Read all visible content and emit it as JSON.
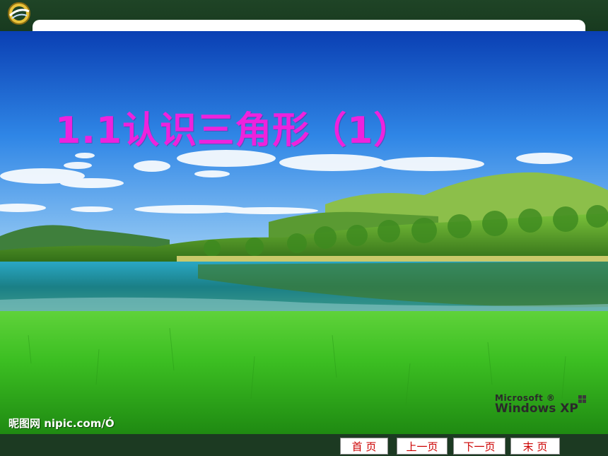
{
  "slide": {
    "title": "1.1认识三角形（1）",
    "title_color": "#ee22dd"
  },
  "watermarks": {
    "left": "昵图网 nipic.com/Ó",
    "right_line1": "Microsoft ®",
    "right_line2": "Windows XP"
  },
  "navigation": {
    "first": "首 页",
    "prev": "上一页",
    "next": "下一页",
    "last": "末 页",
    "text_color": "#cc0000"
  },
  "icons": {
    "logo": "emblem-logo-icon",
    "windows": "windows-flag-icon"
  }
}
